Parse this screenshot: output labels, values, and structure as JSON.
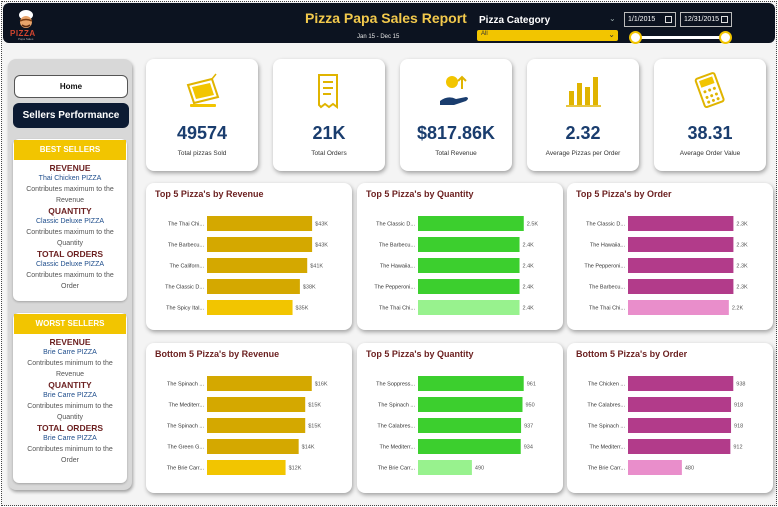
{
  "header": {
    "logo_text": "PIZZA",
    "logo_sub": "Papa Sales",
    "title": "Pizza Papa Sales Report",
    "date_range": "Jan 15 - Dec 15",
    "category_label": "Pizza Category",
    "category_value": "All",
    "date_start": "1/1/2015",
    "date_end": "12/31/2015",
    "slider_start": 0,
    "slider_end": 1
  },
  "sidebar": {
    "home_label": "Home",
    "sellers_label": "Sellers Performance",
    "best": {
      "title": "BEST SELLERS",
      "revenue_h": "REVENUE",
      "revenue_p": "Thai Chicken PIZZA",
      "revenue_d1": "Contributes maximum to the",
      "revenue_d2": "Revenue",
      "quantity_h": "QUANTITY",
      "quantity_p": "Classic Deluxe PIZZA",
      "quantity_d1": "Contributes maximum to the",
      "quantity_d2": "Quantity",
      "orders_h": "TOTAL ORDERS",
      "orders_p": "Classic Deluxe PIZZA",
      "orders_d1": "Contributes maximum to the",
      "orders_d2": "Order"
    },
    "worst": {
      "title": "WORST SELLERS",
      "revenue_h": "REVENUE",
      "revenue_p": "Brie Carre PIZZA",
      "revenue_d1": "Contributes minimum to the",
      "revenue_d2": "Revenue",
      "quantity_h": "QUANTITY",
      "quantity_p": "Brie Carre PIZZA",
      "quantity_d1": "Contributes minimum to the",
      "quantity_d2": "Quantity",
      "orders_h": "TOTAL ORDERS",
      "orders_p": "Brie Carre PIZZA",
      "orders_d1": "Contributes minimum to the",
      "orders_d2": "Order"
    }
  },
  "kpis": [
    {
      "icon": "sold-tag-icon",
      "value": "49574",
      "label": "Total pizzas Sold"
    },
    {
      "icon": "receipt-icon",
      "value": "21K",
      "label": "Total Orders"
    },
    {
      "icon": "money-hand-icon",
      "value": "$817.86K",
      "label": "Total Revenue"
    },
    {
      "icon": "bar-chart-icon",
      "value": "2.32",
      "label": "Average Pizzas per Order"
    },
    {
      "icon": "calculator-icon",
      "value": "38.31",
      "label": "Average Order Value"
    }
  ],
  "colors": {
    "revenue": "#d4a800",
    "revenue_light": "#f2c500",
    "quantity": "#3ccf2e",
    "quantity_light": "#98f28e",
    "orders": "#b23b8a",
    "orders_light": "#e98ecb",
    "header_bg": "#0c1320",
    "title_accent": "#f2c94c"
  },
  "chart_data": [
    {
      "type": "bar",
      "title": "Top 5 Pizza's by Revenue",
      "categories": [
        "The Thai Chi...",
        "The Barbecu...",
        "The Californ...",
        "The Classic D...",
        "The Spicy Ital..."
      ],
      "values": [
        43,
        43,
        41,
        38,
        35
      ],
      "labels": [
        "$43K",
        "$43K",
        "$41K",
        "$38K",
        "$35K"
      ],
      "xlim": [
        0,
        45
      ]
    },
    {
      "type": "bar",
      "title": "Top 5 Pizza's by Quantity",
      "categories": [
        "The Classic D...",
        "The Barbecu...",
        "The Hawaiia...",
        "The Pepperoni...",
        "The Thai Chi..."
      ],
      "values": [
        2.5,
        2.4,
        2.4,
        2.4,
        2.4
      ],
      "labels": [
        "2.5K",
        "2.4K",
        "2.4K",
        "2.4K",
        "2.4K"
      ],
      "xlim": [
        0,
        2.6
      ]
    },
    {
      "type": "bar",
      "title": "Top 5 Pizza's by Order",
      "categories": [
        "The Classic D...",
        "The Hawaiia...",
        "The Pepperoni...",
        "The Barbecu...",
        "The Thai Chi..."
      ],
      "values": [
        2.3,
        2.3,
        2.3,
        2.3,
        2.2
      ],
      "labels": [
        "2.3K",
        "2.3K",
        "2.3K",
        "2.3K",
        "2.2K"
      ],
      "xlim": [
        0,
        2.4
      ]
    },
    {
      "type": "bar",
      "title": "Bottom 5 Pizza's by Revenue",
      "categories": [
        "The Spinach ...",
        "The Mediterr...",
        "The Spinach ...",
        "The Green G...",
        "The Brie Carr..."
      ],
      "values": [
        16,
        15,
        15,
        14,
        12
      ],
      "labels": [
        "$16K",
        "$15K",
        "$15K",
        "$14K",
        "$12K"
      ],
      "xlim": [
        0,
        16.8
      ]
    },
    {
      "type": "bar",
      "title": "Top 5 Pizza's by Quantity",
      "categories": [
        "The Soppress...",
        "The Spinach ...",
        "The Calabres...",
        "The Mediterr...",
        "The Brie Carr..."
      ],
      "values": [
        961,
        950,
        937,
        934,
        490
      ],
      "labels": [
        "961",
        "950",
        "937",
        "934",
        "490"
      ],
      "xlim": [
        0,
        1000
      ]
    },
    {
      "type": "bar",
      "title": "Bottom 5 Pizza's by Order",
      "categories": [
        "The Chicken ...",
        "The Calabres...",
        "The Spinach ...",
        "The Mediterr...",
        "The Brie Carr..."
      ],
      "values": [
        938,
        918,
        918,
        912,
        480
      ],
      "labels": [
        "938",
        "918",
        "918",
        "912",
        "480"
      ],
      "xlim": [
        0,
        980
      ]
    }
  ]
}
